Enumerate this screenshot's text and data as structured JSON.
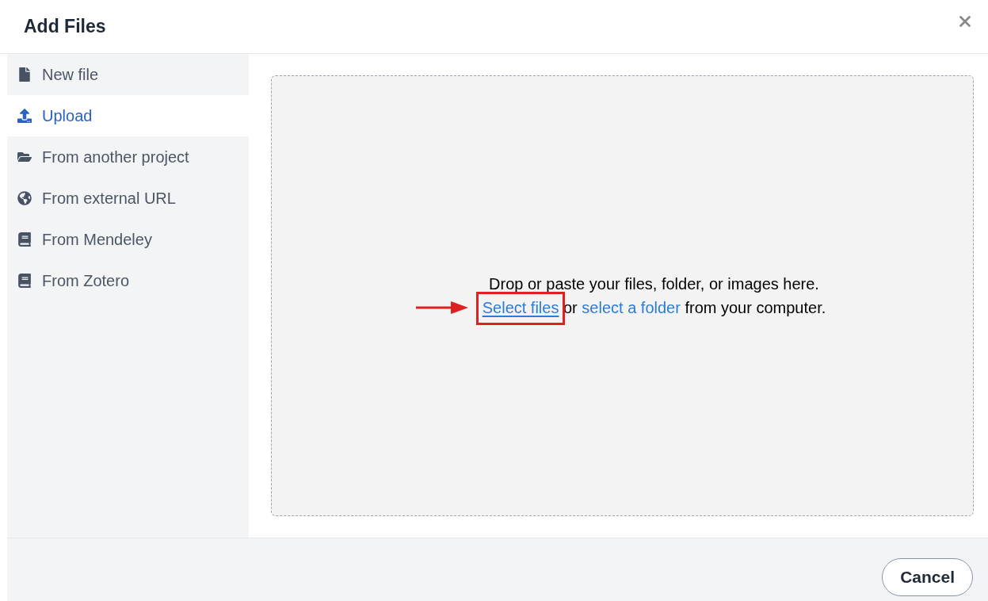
{
  "dialog": {
    "title": "Add Files"
  },
  "sidebar": {
    "items": [
      {
        "kind": "file",
        "label": "New file",
        "selected": false
      },
      {
        "kind": "upload",
        "label": "Upload",
        "selected": true
      },
      {
        "kind": "folder",
        "label": "From another project",
        "selected": false
      },
      {
        "kind": "globe",
        "label": "From external URL",
        "selected": false
      },
      {
        "kind": "book",
        "label": "From Mendeley",
        "selected": false
      },
      {
        "kind": "book",
        "label": "From Zotero",
        "selected": false
      }
    ]
  },
  "dropzone": {
    "message": "Drop or paste your files, folder, or images here.",
    "select_files_link": {
      "label": "Select files",
      "highlighted": true
    },
    "connector": "or",
    "select_folder_link": {
      "label": "select a folder"
    },
    "suffix": "from your computer."
  },
  "footer": {
    "buttons": [
      "Cancel"
    ]
  }
}
